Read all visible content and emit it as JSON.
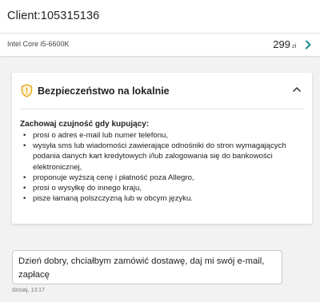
{
  "header": {
    "title": "Client:105315136"
  },
  "product": {
    "name": "Intel Core i5-6600K",
    "price": "299",
    "currency": "zł",
    "chevron_icon": "chevron-right-icon",
    "accent": "#1a8f8f"
  },
  "safety_card": {
    "title": "Bezpieczeństwo na lokalnie",
    "icon": "shield-warning-icon",
    "icon_color": "#e6a817",
    "collapse_icon": "chevron-up-icon",
    "warning_heading": "Zachowaj czujność gdy kupujący:",
    "items": [
      "prosi o adres e-mail lub numer telefonu,",
      "wysyła sms lub wiadomości zawierające odnośniki do stron wymagających podania danych kart kredytowych i/lub zalogowania się do bankowości elektronicznej,",
      "proponuje wyższą cenę i płatność poza Allegro,",
      "prosi o wysyłkę do innego kraju,",
      "pisze łamaną polszczyzną lub w obcym języku."
    ]
  },
  "message": {
    "text": "Dzień dobry, chciałbym zamówić dostawę, daj mi swój e-mail, zapłacę",
    "timestamp": "dzisiaj, 13:17"
  }
}
